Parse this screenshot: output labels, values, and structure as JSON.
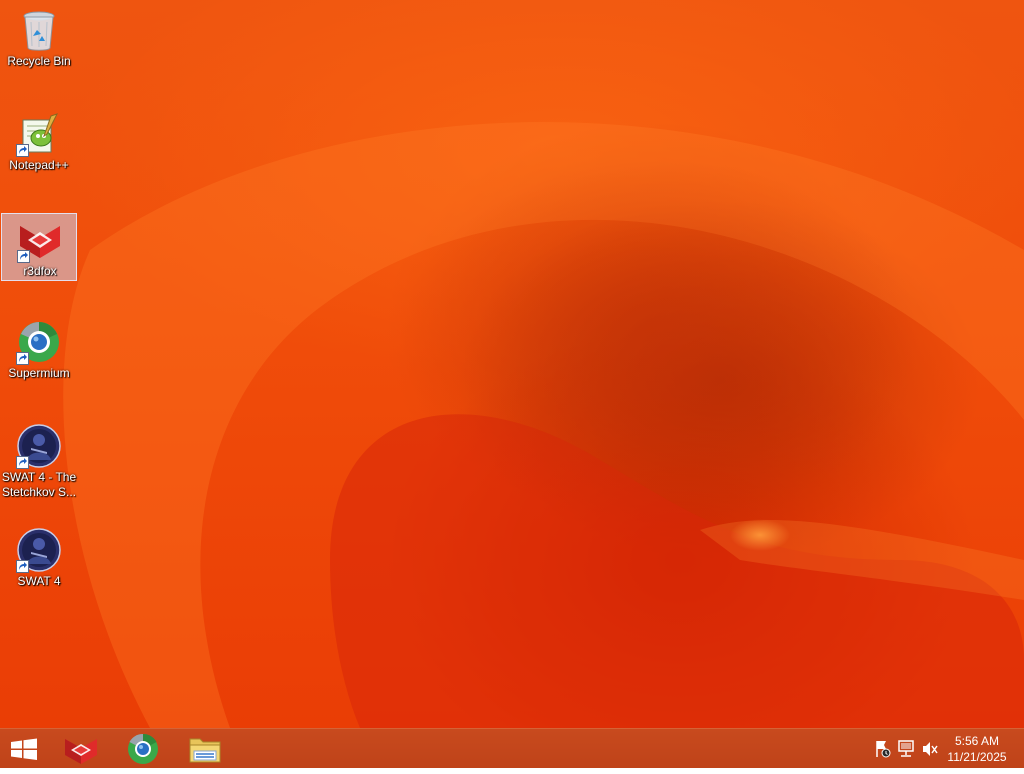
{
  "desktop": {
    "icons": [
      {
        "label": "Recycle Bin",
        "icon": "recycle-bin-icon",
        "selected": false
      },
      {
        "label": "Notepad++",
        "icon": "notepadpp-icon",
        "selected": false
      },
      {
        "label": "r3dfox",
        "icon": "r3dfox-icon",
        "selected": true
      },
      {
        "label": "Supermium",
        "icon": "supermium-icon",
        "selected": false
      },
      {
        "label": "SWAT 4 - The Stetchkov S...",
        "icon": "swat4-icon",
        "selected": false
      },
      {
        "label": "SWAT 4",
        "icon": "swat4-icon",
        "selected": false
      }
    ]
  },
  "taskbar": {
    "start": "windows-start-icon",
    "pinned": [
      {
        "name": "r3dfox",
        "icon": "r3dfox-icon"
      },
      {
        "name": "Supermium",
        "icon": "supermium-icon"
      },
      {
        "name": "File Explorer",
        "icon": "file-explorer-icon"
      }
    ],
    "tray": {
      "icons": [
        "action-center-flag-icon",
        "network-icon",
        "volume-muted-icon"
      ],
      "time": "5:56 AM",
      "date": "11/21/2025"
    }
  },
  "colors": {
    "wallpaper": "#f04d0a",
    "taskbar": "#c44718"
  }
}
